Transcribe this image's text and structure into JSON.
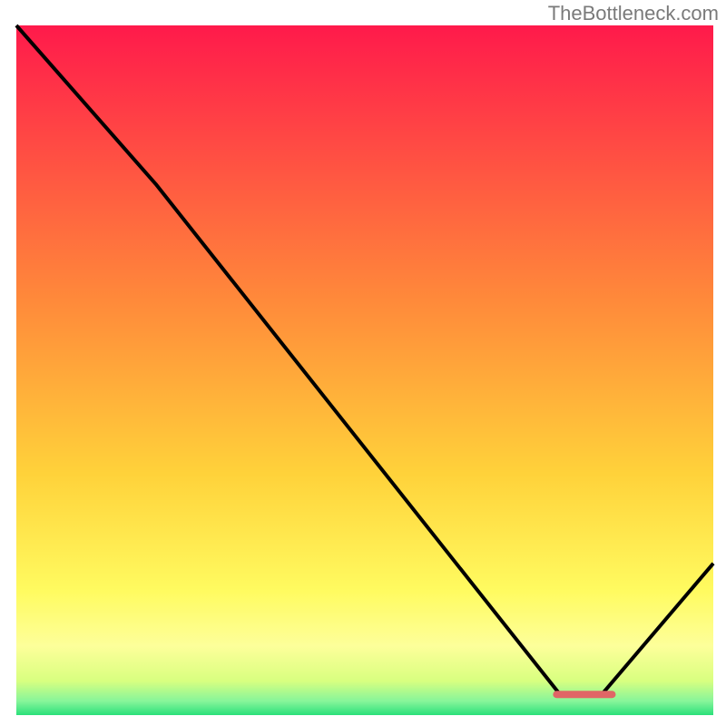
{
  "attribution": "TheBottleneck.com",
  "chart_data": {
    "type": "line",
    "title": "",
    "xlabel": "",
    "ylabel": "",
    "xlim": [
      0,
      100
    ],
    "ylim": [
      0,
      100
    ],
    "x": [
      0,
      20,
      78,
      84,
      100
    ],
    "values": [
      100,
      77,
      3,
      3,
      22
    ],
    "optimal_marker": {
      "x_start": 77,
      "x_end": 86,
      "y": 3
    },
    "background_gradient": {
      "type": "vertical",
      "stops": [
        {
          "pos": 0.0,
          "color": "#ff1a4b"
        },
        {
          "pos": 0.4,
          "color": "#ff8a3a"
        },
        {
          "pos": 0.65,
          "color": "#ffd23a"
        },
        {
          "pos": 0.82,
          "color": "#fffb60"
        },
        {
          "pos": 0.9,
          "color": "#fdff9a"
        },
        {
          "pos": 0.95,
          "color": "#d9ff80"
        },
        {
          "pos": 0.98,
          "color": "#86f59a"
        },
        {
          "pos": 1.0,
          "color": "#2be07a"
        }
      ]
    },
    "line_color": "#000000",
    "marker_color": "#e06666"
  }
}
